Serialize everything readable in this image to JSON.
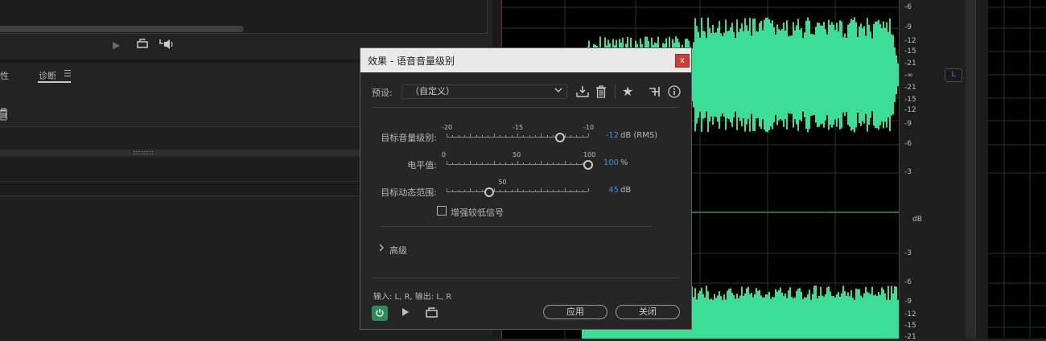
{
  "left_panel": {
    "tab_partial": "性",
    "tab_diagnostics": "诊断",
    "tab_menu_glyph": "☰"
  },
  "ruler": {
    "upper": [
      "-6",
      "-9",
      "-12",
      "-15",
      "-21",
      "-∞",
      "-21",
      "-15",
      "-12",
      "-9",
      "-6",
      "-3"
    ],
    "unit": "dB",
    "lower": [
      "-3",
      "-6",
      "-9",
      "-12",
      "-15",
      "-21"
    ],
    "channel_badge": "L"
  },
  "dialog": {
    "title": "效果 - 语音音量级别",
    "close_label": "x",
    "preset_label": "预设:",
    "preset_value": "（自定义）",
    "params": [
      {
        "label": "目标音量级别:",
        "value": "-12",
        "unit": "dB (RMS)",
        "ticks": [
          "-20",
          "-15",
          "-10"
        ],
        "fraction": 0.8
      },
      {
        "label": "电平值:",
        "value": "100",
        "unit": "%",
        "ticks": [
          "0",
          "50",
          "100"
        ],
        "fraction": 1.0
      },
      {
        "label": "目标动态范围:",
        "value": "45",
        "unit": "dB",
        "ticks": [
          "50"
        ],
        "fraction": 0.3
      }
    ],
    "checkbox_label": "增强较低信号",
    "checkbox_checked": false,
    "advanced_label": "高级",
    "io_text": "输入: L, R,   输出: L, R",
    "apply_label": "应用",
    "close_button_label": "关闭"
  },
  "colors": {
    "waveform": "#3ddc97",
    "accent_value": "#3d8fe0",
    "power_on": "#2e8a5a",
    "close_red": "#c9403a"
  }
}
